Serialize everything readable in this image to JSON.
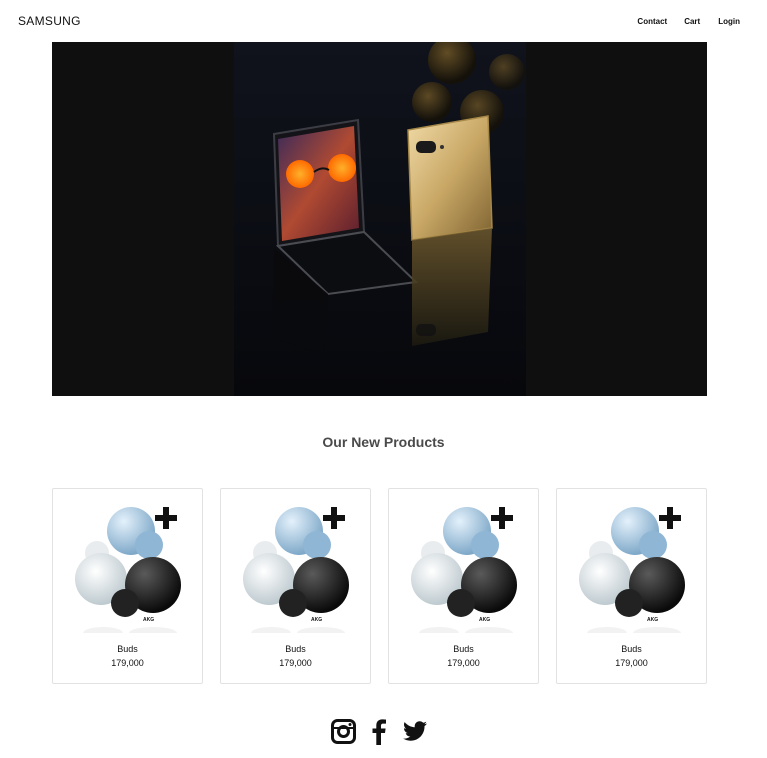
{
  "navbar": {
    "logo": "SAMSUNG",
    "links": [
      {
        "label": "Contact"
      },
      {
        "label": "Cart"
      },
      {
        "label": "Login"
      }
    ]
  },
  "hero": {
    "image": "folding-phone-promo-image"
  },
  "products_section": {
    "title": "Our New Products",
    "products": [
      {
        "name": "Buds",
        "price": "179,000",
        "badge_text": "AKG"
      },
      {
        "name": "Buds",
        "price": "179,000",
        "badge_text": "AKG"
      },
      {
        "name": "Buds",
        "price": "179,000",
        "badge_text": "AKG"
      },
      {
        "name": "Buds",
        "price": "179,000",
        "badge_text": "AKG"
      }
    ]
  },
  "social": {
    "icons": [
      "instagram-icon",
      "facebook-icon",
      "twitter-icon"
    ]
  }
}
